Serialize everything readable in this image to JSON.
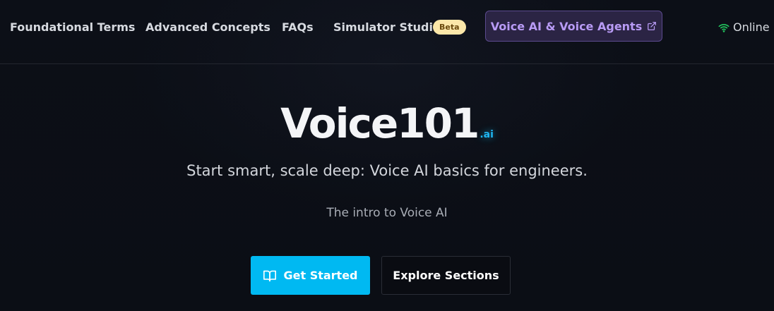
{
  "nav": {
    "links": [
      {
        "label": "Foundational Terms"
      },
      {
        "label": "Advanced Concepts"
      },
      {
        "label": "FAQs"
      },
      {
        "label": "Simulator Studio"
      }
    ],
    "beta_badge": "Beta",
    "voice_button": {
      "label": "Voice AI & Voice Agents",
      "icon": "external-link-icon"
    },
    "status": {
      "label": "Online",
      "icon": "wifi-icon",
      "color": "#22c55e"
    }
  },
  "hero": {
    "logo_main": "Voice101",
    "logo_suffix": ".ai",
    "tagline": "Start smart, scale deep: Voice AI basics for engineers.",
    "subtitle": "The intro to Voice AI",
    "primary_button": {
      "label": "Get Started",
      "icon": "book-open-icon"
    },
    "secondary_button": {
      "label": "Explore Sections"
    }
  },
  "colors": {
    "background": "#0b0e16",
    "accent": "#00b9f2",
    "purple_accent": "#b89bf5",
    "beta_bg": "#fbe7a9"
  }
}
